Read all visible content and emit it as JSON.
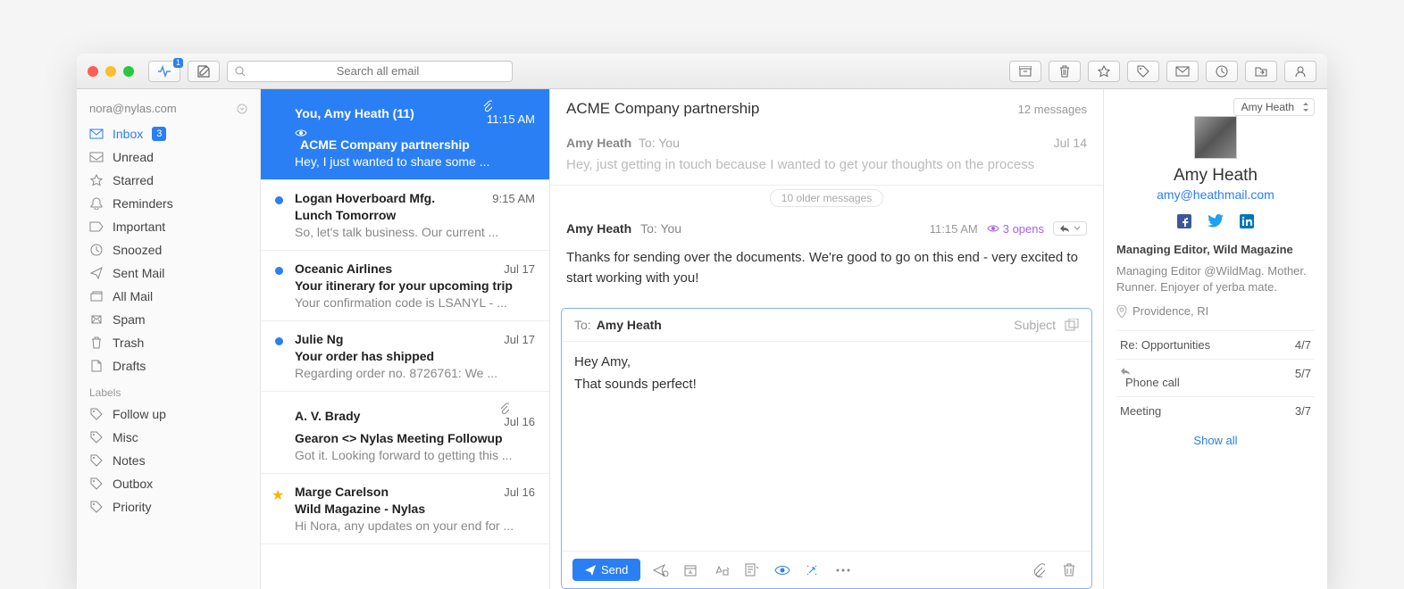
{
  "titlebar": {
    "activity_badge": "1",
    "search_placeholder": "Search all email"
  },
  "sidebar": {
    "account": "nora@nylas.com",
    "folders": [
      {
        "icon": "inbox",
        "label": "Inbox",
        "count": "3",
        "active": true
      },
      {
        "icon": "unread",
        "label": "Unread"
      },
      {
        "icon": "star",
        "label": "Starred"
      },
      {
        "icon": "bell",
        "label": "Reminders"
      },
      {
        "icon": "important",
        "label": "Important"
      },
      {
        "icon": "clock",
        "label": "Snoozed"
      },
      {
        "icon": "sent",
        "label": "Sent Mail"
      },
      {
        "icon": "all",
        "label": "All Mail"
      },
      {
        "icon": "spam",
        "label": "Spam"
      },
      {
        "icon": "trash",
        "label": "Trash"
      },
      {
        "icon": "drafts",
        "label": "Drafts"
      }
    ],
    "labels_header": "Labels",
    "labels": [
      {
        "label": "Follow up"
      },
      {
        "label": "Misc"
      },
      {
        "label": "Notes"
      },
      {
        "label": "Outbox"
      },
      {
        "label": "Priority"
      }
    ]
  },
  "threads": [
    {
      "from": "You, Amy Heath (11)",
      "time": "11:15 AM",
      "subject": "ACME Company partnership",
      "preview": "Hey, I just wanted to share some ...",
      "selected": true,
      "attach": true,
      "tracked": true
    },
    {
      "from": "Logan Hoverboard Mfg.",
      "time": "9:15 AM",
      "subject": "Lunch Tomorrow",
      "preview": "So, let's talk business. Our current ...",
      "unread": true
    },
    {
      "from": "Oceanic Airlines",
      "time": "Jul 17",
      "subject": "Your itinerary for your upcoming trip",
      "preview": "Your confirmation code is LSANYL - ...",
      "unread": true
    },
    {
      "from": "Julie Ng",
      "time": "Jul 17",
      "subject": "Your order has shipped",
      "preview": "Regarding order no. 8726761: We ...",
      "unread": true
    },
    {
      "from": "A. V. Brady",
      "time": "Jul 16",
      "subject": "Gearon <> Nylas Meeting Followup",
      "preview": "Got it. Looking forward to getting this ...",
      "attach": true
    },
    {
      "from": "Marge Carelson",
      "time": "Jul 16",
      "subject": "Wild Magazine - Nylas",
      "preview": "Hi Nora, any updates on your end for ...",
      "starred": true
    }
  ],
  "reader": {
    "subject": "ACME Company partnership",
    "count": "12 messages",
    "msg1": {
      "from": "Amy Heath",
      "to_label": "To:",
      "to": "You",
      "date": "Jul 14",
      "body": "Hey, just getting in touch because I wanted to get your thoughts on the process"
    },
    "older": "10 older messages",
    "msg2": {
      "from": "Amy Heath",
      "to_label": "To:",
      "to": "You",
      "time": "11:15 AM",
      "opens": "3 opens",
      "body": "Thanks for sending over the documents. We're good to go on this end - very excited to start working with you!"
    }
  },
  "composer": {
    "to_label": "To:",
    "to": "Amy Heath",
    "subject_label": "Subject",
    "body_line1": "Hey Amy,",
    "body_line2": "That sounds perfect!",
    "send": "Send"
  },
  "contact": {
    "selector": "Amy Heath",
    "name": "Amy Heath",
    "email": "amy@heathmail.com",
    "title": "Managing Editor, Wild Magazine",
    "bio": "Managing Editor @WildMag. Mother. Runner. Enjoyer of yerba mate.",
    "location": "Providence, RI",
    "related": [
      {
        "label": "Re: Opportunities",
        "meta": "4/7"
      },
      {
        "label": "Phone call",
        "meta": "5/7",
        "reply": true
      },
      {
        "label": "Meeting",
        "meta": "3/7"
      }
    ],
    "showall": "Show all"
  }
}
